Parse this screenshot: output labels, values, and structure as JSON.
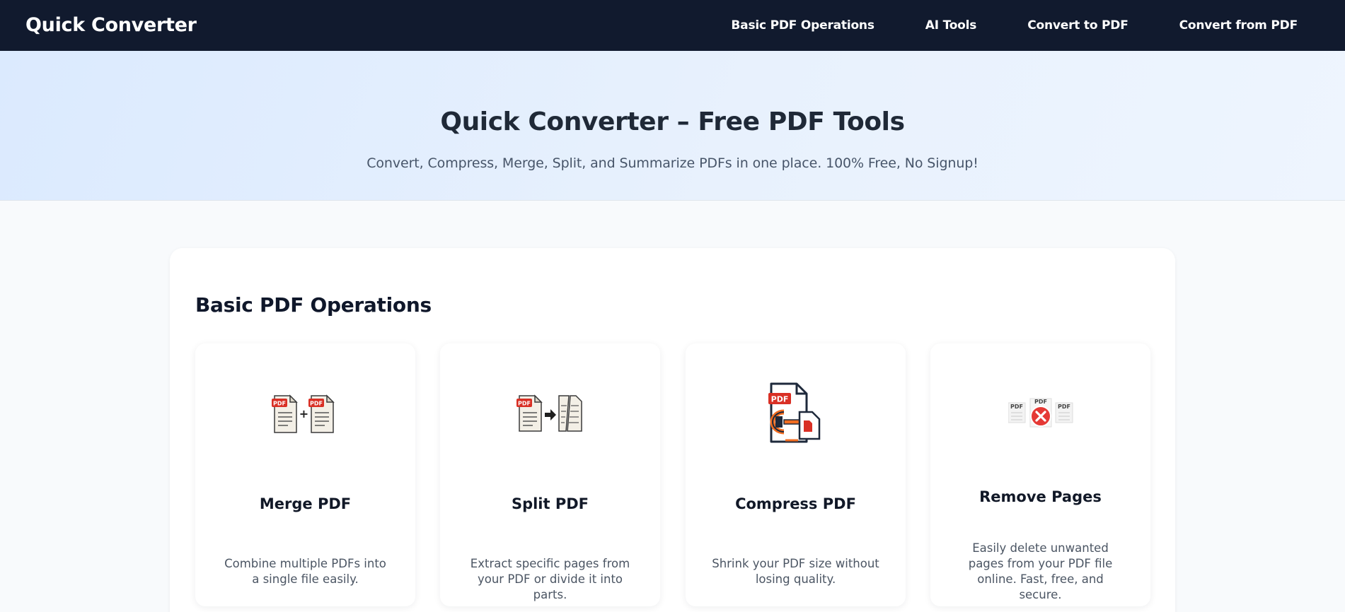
{
  "header": {
    "brand": "Quick Converter",
    "nav": [
      "Basic PDF Operations",
      "AI Tools",
      "Convert to PDF",
      "Convert from PDF"
    ]
  },
  "hero": {
    "title": "Quick Converter – Free PDF Tools",
    "subtitle": "Convert, Compress, Merge, Split, and Summarize PDFs in one place. 100% Free, No Signup!"
  },
  "section": {
    "title": "Basic PDF Operations",
    "tools": [
      {
        "title": "Merge PDF",
        "description": "Combine multiple PDFs into a single file easily.",
        "icon": "merge-pdf-icon"
      },
      {
        "title": "Split PDF",
        "description": "Extract specific pages from your PDF or divide it into parts.",
        "icon": "split-pdf-icon"
      },
      {
        "title": "Compress PDF",
        "description": "Shrink your PDF size without losing quality.",
        "icon": "compress-pdf-icon"
      },
      {
        "title": "Remove Pages",
        "description": "Easily delete unwanted pages from your PDF file online. Fast, free, and secure.",
        "icon": "remove-pages-icon"
      }
    ]
  },
  "icon_labels": {
    "pdf": "PDF",
    "plus": "+"
  },
  "colors": {
    "header_bg": "#111a2e",
    "pdf_red": "#d93025",
    "accent_orange": "#f26d21",
    "text_dark": "#0f172a"
  }
}
